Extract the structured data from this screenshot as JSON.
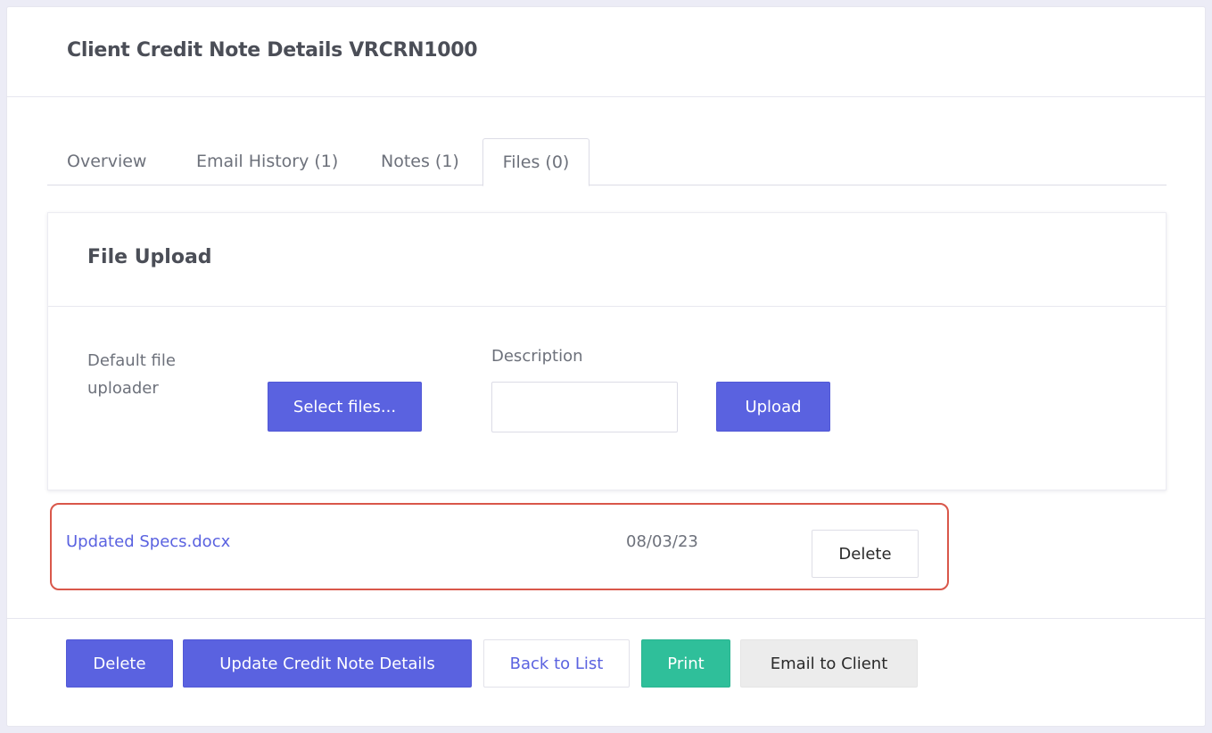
{
  "header": {
    "title": "Client Credit Note Details VRCRN1000"
  },
  "tabs": [
    {
      "label": "Overview",
      "active": false
    },
    {
      "label": "Email History (1)",
      "active": false
    },
    {
      "label": "Notes (1)",
      "active": false
    },
    {
      "label": "Files (0)",
      "active": true
    }
  ],
  "upload": {
    "title": "File Upload",
    "uploader_label": "Default file uploader",
    "select_button": "Select files...",
    "description_label": "Description",
    "description_value": "",
    "upload_button": "Upload"
  },
  "files": [
    {
      "name": "Updated Specs.docx",
      "date": "08/03/23",
      "delete_label": "Delete"
    }
  ],
  "footer": {
    "delete": "Delete",
    "update": "Update Credit Note Details",
    "back": "Back to List",
    "print": "Print",
    "email": "Email to Client"
  },
  "colors": {
    "primary": "#5a62e0",
    "success": "#2fbf9a",
    "highlight_border": "#d9574a",
    "background": "#ececf6"
  }
}
